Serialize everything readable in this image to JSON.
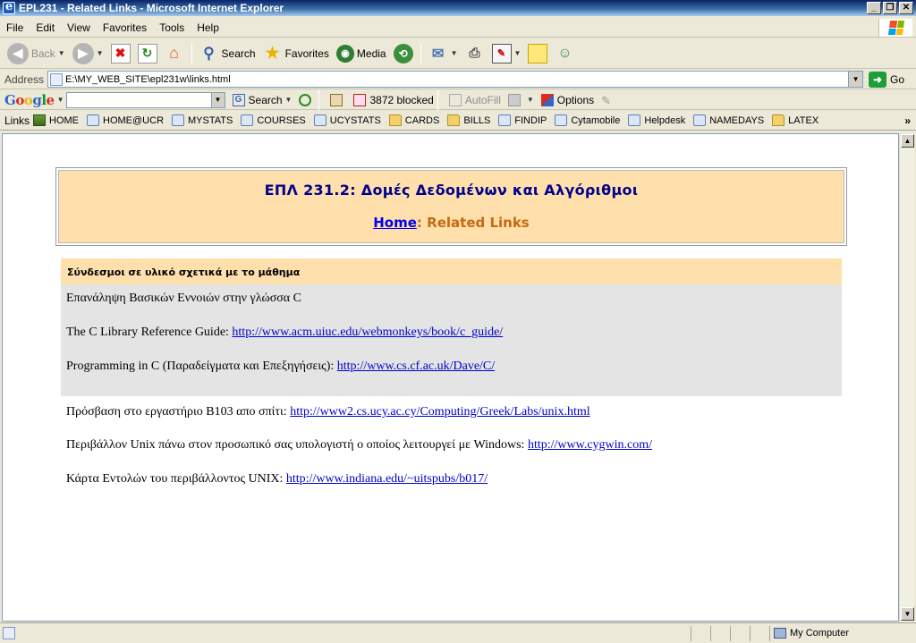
{
  "window": {
    "title": "EPL231 - Related Links - Microsoft Internet Explorer",
    "buttons": [
      "_",
      "❐",
      "✕"
    ]
  },
  "menu": {
    "items": [
      "File",
      "Edit",
      "View",
      "Favorites",
      "Tools",
      "Help"
    ]
  },
  "toolbar": {
    "back_label": "Back",
    "search_label": "Search",
    "favorites_label": "Favorites",
    "media_label": "Media"
  },
  "address": {
    "label": "Address",
    "url": "E:\\MY_WEB_SITE\\epl231w\\links.html",
    "go_label": "Go"
  },
  "google": {
    "logo": "Google",
    "search_label": "Search",
    "blocked_label": "3872 blocked",
    "autofill_label": "AutoFill",
    "options_label": "Options"
  },
  "links": {
    "label": "Links",
    "items": [
      {
        "label": "HOME",
        "icon": "home-icon"
      },
      {
        "label": "HOME@UCR",
        "icon": "page-icon"
      },
      {
        "label": "MYSTATS",
        "icon": "page-icon"
      },
      {
        "label": "COURSES",
        "icon": "page-icon"
      },
      {
        "label": "UCYSTATS",
        "icon": "page-icon"
      },
      {
        "label": "CARDS",
        "icon": "folder-icon"
      },
      {
        "label": "BILLS",
        "icon": "folder-icon"
      },
      {
        "label": "FINDIP",
        "icon": "page-icon"
      },
      {
        "label": "Cytamobile",
        "icon": "page-icon"
      },
      {
        "label": "Helpdesk",
        "icon": "page-icon"
      },
      {
        "label": "NAMEDAYS",
        "icon": "page-icon"
      },
      {
        "label": "LATEX",
        "icon": "folder-icon"
      }
    ],
    "more": "»"
  },
  "page": {
    "course_title": "ΕΠΛ 231.2: Δομές Δεδομένων και Αλγόριθμοι",
    "home_link": "Home",
    "crumb_sep": ":",
    "crumb_current": "Related Links",
    "section_title": "Σύνδεσμοι σε υλικό σχετικά με το μάθημα",
    "grey_heading": "Επανάληψη Βασικών Εννοιών στην γλώσσα C",
    "entries": [
      {
        "text": "The C Library Reference Guide: ",
        "url": "http://www.acm.uiuc.edu/webmonkeys/book/c_guide/"
      },
      {
        "text": "Programming in C (Παραδείγματα και Επεξηγήσεις): ",
        "url": "http://www.cs.cf.ac.uk/Dave/C/"
      },
      {
        "text": "Πρόσβαση στο εργαστήριο Β103 απο σπίτι: ",
        "url": "http://www2.cs.ucy.ac.cy/Computing/Greek/Labs/unix.html"
      },
      {
        "text": "Περιβάλλον Unix πάνω στον προσωπικό σας υπολογιστή ο οποίος λειτουργεί με Windows: ",
        "url": "http://www.cygwin.com/"
      },
      {
        "text": "Κάρτα Εντολών του περιβάλλοντος UNIX: ",
        "url": "http://www.indiana.edu/~uitspubs/b017/"
      }
    ]
  },
  "status": {
    "zone": "My Computer"
  },
  "colors": {
    "header_bg": "#ffe0ad",
    "title_color": "#00008b",
    "crumb_color": "#c56a10",
    "grey_bg": "#e4e4e4",
    "link_color": "#0000cc"
  }
}
